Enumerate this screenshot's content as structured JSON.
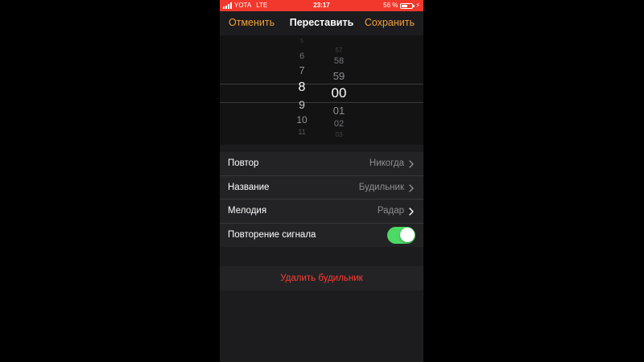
{
  "status_bar": {
    "carrier": "YOTA",
    "network": "LTE",
    "time": "23:17",
    "battery_percent": "56 %",
    "battery_level": 0.56
  },
  "nav": {
    "cancel_label": "Отменить",
    "title": "Переставить",
    "save_label": "Сохранить"
  },
  "picker": {
    "hours": [
      "5",
      "6",
      "7",
      "8",
      "9",
      "10",
      "11"
    ],
    "minutes": [
      "57",
      "58",
      "59",
      "00",
      "01",
      "02",
      "03"
    ],
    "selected_hour": "8",
    "selected_minute": "00"
  },
  "settings": {
    "repeat_label": "Повтор",
    "repeat_value": "Никогда",
    "name_label": "Название",
    "name_value": "Будильник",
    "sound_label": "Мелодия",
    "sound_value": "Радар",
    "snooze_label": "Повторение сигнала",
    "snooze_on": true
  },
  "delete_label": "Удалить будильник",
  "colors": {
    "status_bar": "#f2382c",
    "accent": "#f5a13a",
    "toggle_on": "#4cd964",
    "destructive": "#ff3b30"
  }
}
